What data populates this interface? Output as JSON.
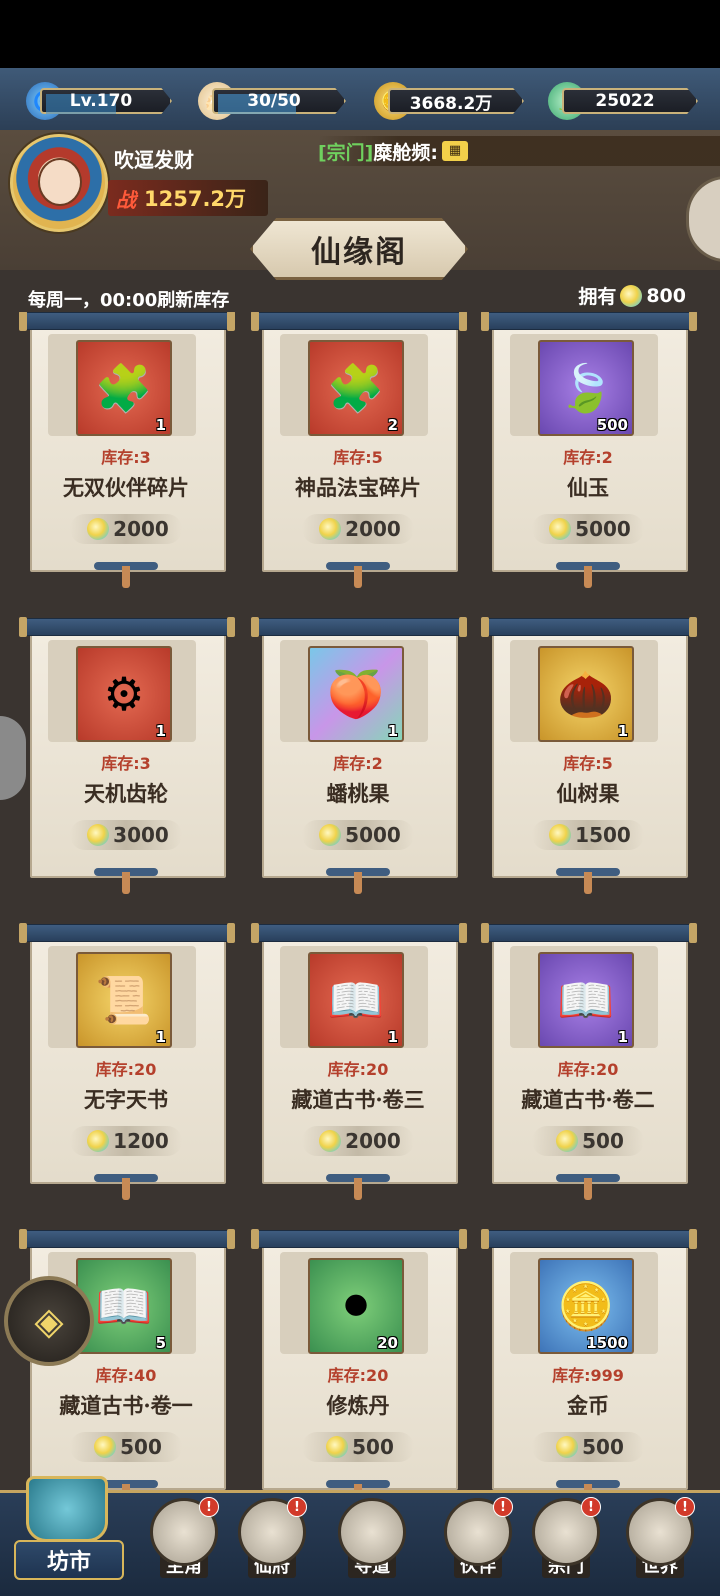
{
  "topbar": {
    "level": "Lv.170",
    "level_fill": 0.55,
    "stamina": "30/50",
    "stamina_fill": 0.6,
    "gold": "3668.2万",
    "jade": "25022"
  },
  "player": {
    "name": "吹逗发财",
    "power_label": "战",
    "power_value": "1257.2万"
  },
  "marquee": {
    "tag": "[宗门]",
    "text": "糜舱频:"
  },
  "shop": {
    "title": "仙缘阁",
    "refresh_note": "每周一，00:00刷新库存",
    "owned_label": "拥有",
    "owned_amount": "800"
  },
  "items": [
    {
      "name": "无双伙伴碎片",
      "stock": "库存:3",
      "qty": "1",
      "price": "2000",
      "color": "red",
      "icon": "puzzle-piece-icon"
    },
    {
      "name": "神品法宝碎片",
      "stock": "库存:5",
      "qty": "2",
      "price": "2000",
      "color": "red",
      "icon": "puzzle-pieces-icon"
    },
    {
      "name": "仙玉",
      "stock": "库存:2",
      "qty": "500",
      "price": "5000",
      "color": "purple",
      "icon": "jade-leaf-icon"
    },
    {
      "name": "天机齿轮",
      "stock": "库存:3",
      "qty": "1",
      "price": "3000",
      "color": "red",
      "icon": "gear-icon"
    },
    {
      "name": "蟠桃果",
      "stock": "库存:2",
      "qty": "1",
      "price": "5000",
      "color": "prism",
      "icon": "peach-icon"
    },
    {
      "name": "仙树果",
      "stock": "库存:5",
      "qty": "1",
      "price": "1500",
      "color": "gold",
      "icon": "fruit-icon"
    },
    {
      "name": "无字天书",
      "stock": "库存:20",
      "qty": "1",
      "price": "1200",
      "color": "gold",
      "icon": "scroll-book-icon"
    },
    {
      "name": "藏道古书·卷三",
      "stock": "库存:20",
      "qty": "1",
      "price": "2000",
      "color": "red",
      "icon": "open-book-icon"
    },
    {
      "name": "藏道古书·卷二",
      "stock": "库存:20",
      "qty": "1",
      "price": "500",
      "color": "purple",
      "icon": "open-book-icon"
    },
    {
      "name": "藏道古书·卷一",
      "stock": "库存:40",
      "qty": "5",
      "price": "500",
      "color": "green",
      "icon": "open-book-icon"
    },
    {
      "name": "修炼丹",
      "stock": "库存:20",
      "qty": "20",
      "price": "500",
      "color": "green",
      "icon": "pill-icon"
    },
    {
      "name": "金币",
      "stock": "库存:999",
      "qty": "1500",
      "price": "500",
      "color": "blue",
      "icon": "gold-coin-icon"
    }
  ],
  "nav": {
    "market": "坊市",
    "items": [
      {
        "label": "主角",
        "badge": "!"
      },
      {
        "label": "仙府",
        "badge": "!"
      },
      {
        "label": "寻道",
        "badge": ""
      },
      {
        "label": "伙伴",
        "badge": "!"
      },
      {
        "label": "宗门",
        "badge": "!"
      },
      {
        "label": "世界",
        "badge": "!"
      }
    ]
  },
  "icon_glyphs": {
    "puzzle-piece-icon": "🧩",
    "puzzle-pieces-icon": "🧩",
    "jade-leaf-icon": "🍃",
    "gear-icon": "⚙",
    "peach-icon": "🍑",
    "fruit-icon": "🌰",
    "scroll-book-icon": "📜",
    "open-book-icon": "📖",
    "pill-icon": "⚫",
    "gold-coin-icon": "🪙"
  }
}
